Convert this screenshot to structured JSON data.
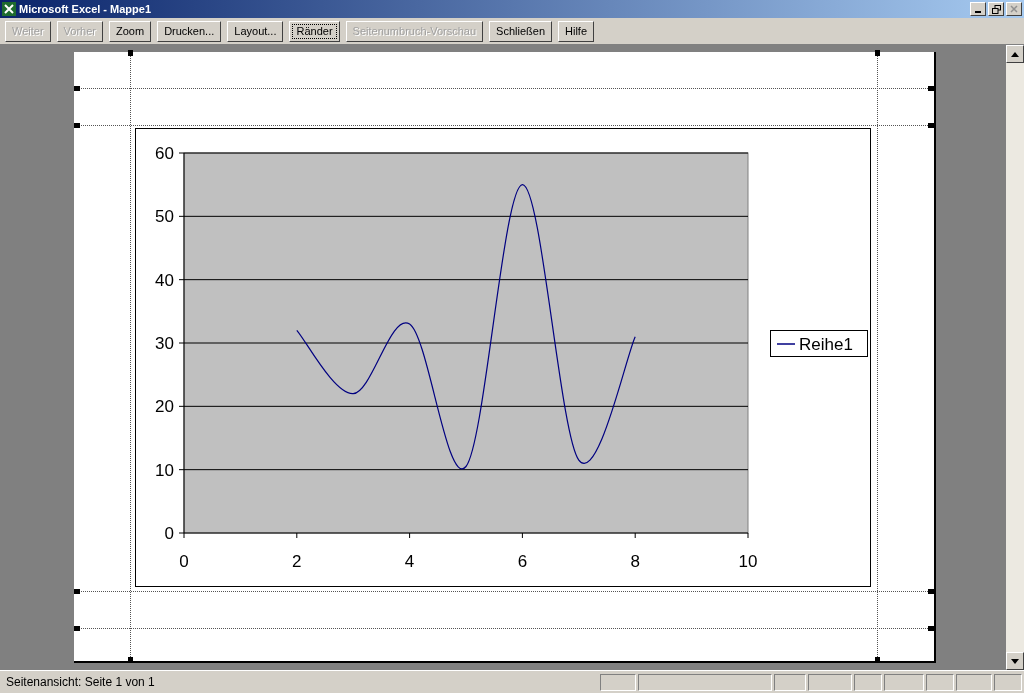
{
  "window": {
    "title": "Microsoft Excel - Mappe1"
  },
  "toolbar": [
    {
      "label": "Weiter",
      "disabled": true,
      "focused": false
    },
    {
      "label": "Vorher",
      "disabled": true,
      "focused": false
    },
    {
      "label": "Zoom",
      "disabled": false,
      "focused": false
    },
    {
      "label": "Drucken...",
      "disabled": false,
      "focused": false
    },
    {
      "label": "Layout...",
      "disabled": false,
      "focused": false
    },
    {
      "label": "Ränder",
      "disabled": false,
      "focused": true
    },
    {
      "label": "Seitenumbruch-Vorschau",
      "disabled": true,
      "focused": false
    },
    {
      "label": "Schließen",
      "disabled": false,
      "focused": false
    },
    {
      "label": "Hilfe",
      "disabled": false,
      "focused": false
    }
  ],
  "chart": {
    "chart_data": {
      "type": "line",
      "x": [
        2,
        3,
        4,
        5,
        6,
        7,
        8
      ],
      "series": [
        {
          "name": "Reihe1",
          "color": "#000080",
          "values": [
            32,
            22,
            33,
            10.5,
            55,
            11.5,
            31
          ]
        }
      ],
      "xlim": [
        0,
        10
      ],
      "ylim": [
        0,
        60
      ],
      "xticks": [
        0,
        2,
        4,
        6,
        8,
        10
      ],
      "yticks": [
        0,
        10,
        20,
        30,
        40,
        50,
        60
      ],
      "grid": true
    }
  },
  "status_bar": {
    "text": "Seitenansicht: Seite 1 von 1"
  }
}
